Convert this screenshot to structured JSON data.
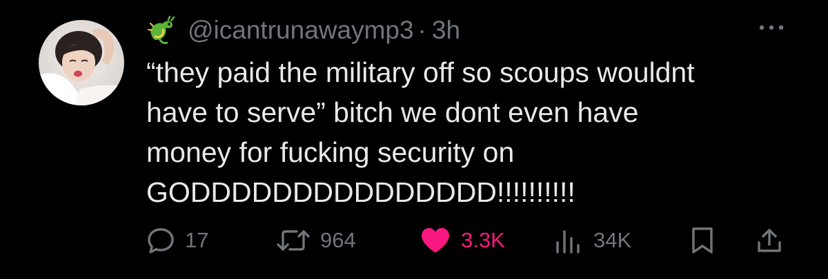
{
  "tweet": {
    "handle": "@icantrunawaymp3",
    "separator": "·",
    "time": "3h",
    "text_lines": [
      "“they paid the military off so scoups wouldnt",
      "have to serve” bitch we dont even have",
      "money for fucking security on",
      "GODDDDDDDDDDDDDDD!!!!!!!!!!"
    ]
  },
  "actions": {
    "replies": "17",
    "retweets": "964",
    "likes": "3.3K",
    "views": "34K"
  },
  "icons": {
    "name_emoji": "dragon-emoji-icon",
    "more": "more-dots-icon",
    "reply": "reply-bubble-icon",
    "retweet": "retweet-arrows-icon",
    "like": "heart-filled-icon",
    "views": "views-bar-chart-icon",
    "bookmark": "bookmark-icon",
    "share": "share-upload-icon"
  },
  "colors": {
    "background": "#000000",
    "text": "#e7e9ea",
    "secondary": "#71767b",
    "like": "#f91880"
  }
}
